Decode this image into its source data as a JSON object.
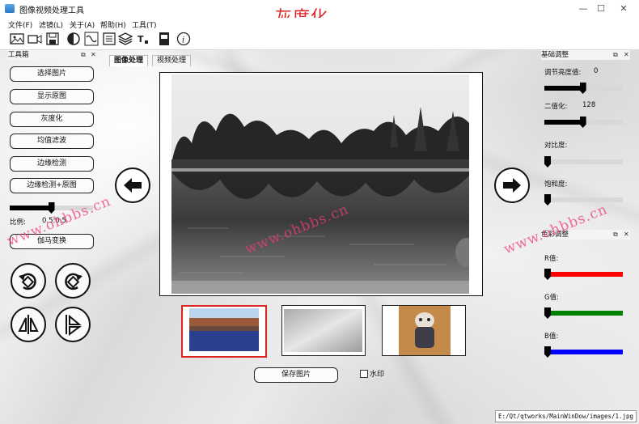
{
  "window": {
    "title": "图像视频处理工具",
    "overlay_title": "灰度化",
    "title_color": "#dd2222"
  },
  "menu": [
    "文件(F)",
    "滤镜(L)",
    "关于(A)",
    "帮助(H)",
    "工具(T)"
  ],
  "toolbar_icons": [
    "image-icon",
    "camera-icon",
    "save-icon",
    "contrast-icon",
    "wave-icon",
    "grid-icon",
    "layers-icon",
    "text-size-icon",
    "export-icon",
    "info-icon"
  ],
  "left_panel": {
    "title": "工具箱",
    "buttons": [
      "选择图片",
      "显示原图",
      "灰度化",
      "均值滤波",
      "边缘检测",
      "边缘检测+原图"
    ],
    "ratio_label": "比例:",
    "ratio_value": "0.5:0.5",
    "ratio_slider": 0.5,
    "gamma_button": "伽马变换",
    "transform_icons": [
      "rotate-left-icon",
      "rotate-right-icon",
      "flip-horizontal-icon",
      "flip-vertical-icon"
    ]
  },
  "center": {
    "tabs": [
      "图像处理",
      "视频处理"
    ],
    "thumbnails": [
      "lake-thumbnail",
      "paper-thumbnail",
      "cat-thumbnail"
    ],
    "save_button": "保存图片",
    "watermark_checkbox": "水印",
    "watermark_checked": false
  },
  "right_panel": {
    "basic_title": "基础调整",
    "brightness_label": "调节亮度值:",
    "brightness_value": "0",
    "brightness_slider": 0.45,
    "binary_label": "二值化:",
    "binary_value": "128",
    "binary_slider": 0.45,
    "contrast_label": "对比度:",
    "contrast_slider": 0.0,
    "saturation_label": "饱和度:",
    "saturation_slider": 0.0,
    "color_title": "色彩调整",
    "r_label": "R值:",
    "g_label": "G值:",
    "b_label": "B值:",
    "r_slider": 0.0,
    "g_slider": 0.0,
    "b_slider": 0.0,
    "r_color": "#ff0000",
    "g_color": "#008000",
    "b_color": "#0000ff"
  },
  "watermark_text": "www.ohbbs.cn",
  "status_path": "E:/Qt/qtworks/MainWinDow/images/1.jpg"
}
